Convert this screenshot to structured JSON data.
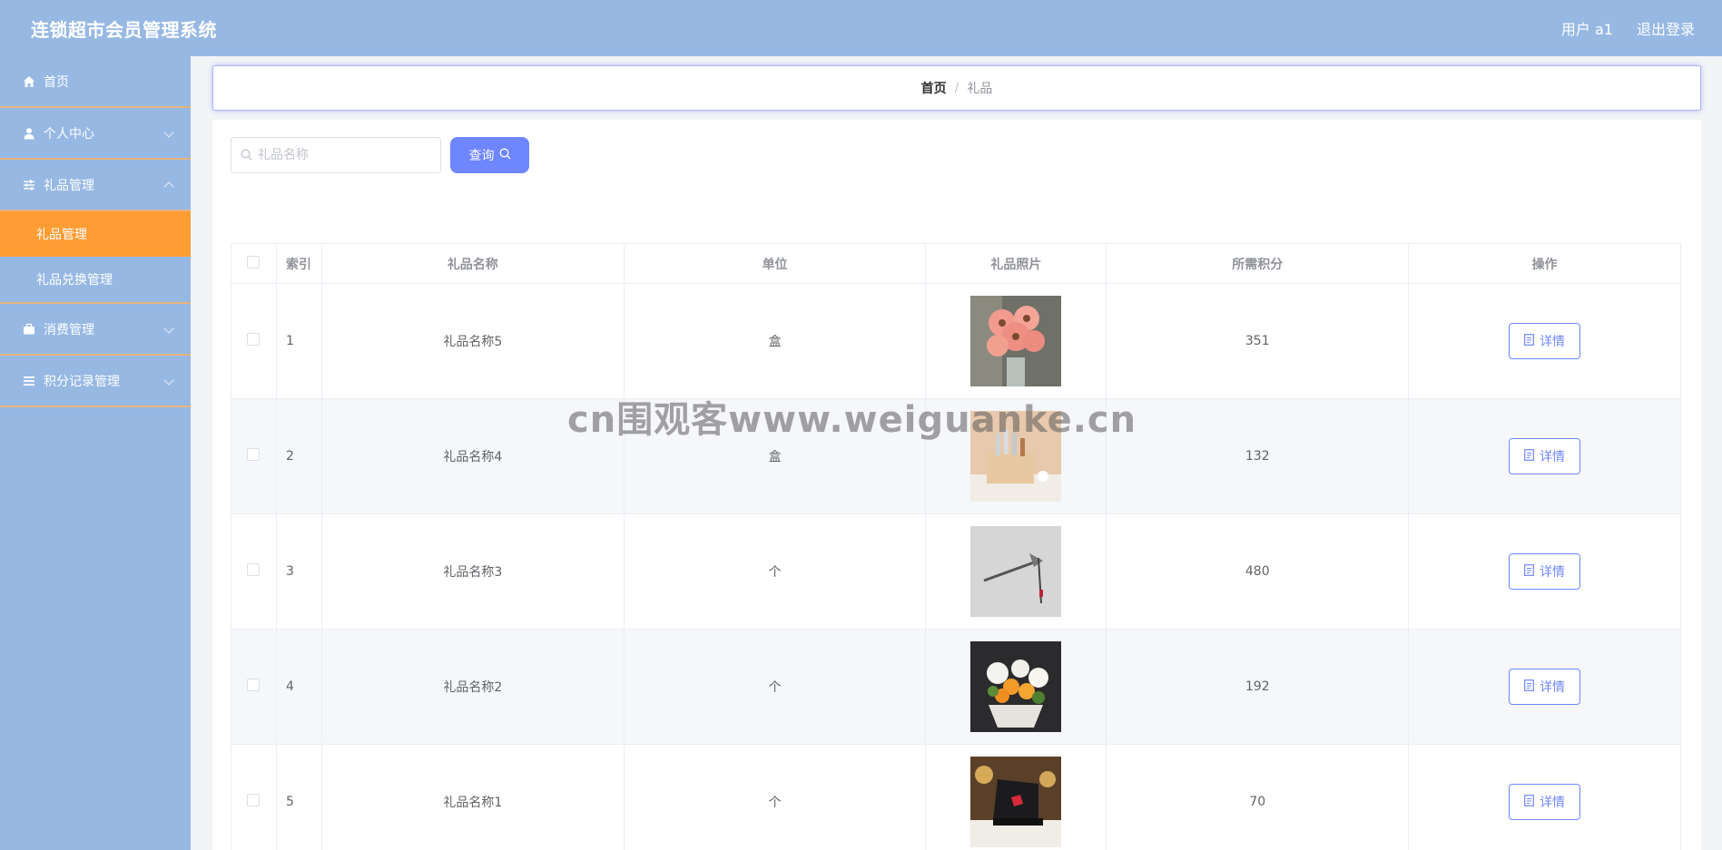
{
  "header": {
    "title": "连锁超市会员管理系统",
    "user": "用户 a1",
    "logout": "退出登录"
  },
  "sidebar": {
    "items": [
      {
        "label": "首页",
        "icon": "home-icon"
      },
      {
        "label": "个人中心",
        "icon": "user-icon"
      },
      {
        "label": "礼品管理",
        "icon": "sliders-icon"
      },
      {
        "label": "消费管理",
        "icon": "briefcase-icon"
      },
      {
        "label": "积分记录管理",
        "icon": "menu-icon"
      }
    ],
    "sub_items": [
      {
        "label": "礼品管理"
      },
      {
        "label": "礼品兑换管理"
      }
    ]
  },
  "breadcrumb": {
    "home": "首页",
    "separator": "/",
    "current": "礼品"
  },
  "search": {
    "placeholder": "礼品名称",
    "value": "",
    "button": "查询"
  },
  "table": {
    "headers": {
      "index": "索引",
      "name": "礼品名称",
      "unit": "单位",
      "photo": "礼品照片",
      "points": "所需积分",
      "actions": "操作"
    },
    "rows": [
      {
        "index": "1",
        "name": "礼品名称5",
        "unit": "盒",
        "points": "351",
        "action": "详情"
      },
      {
        "index": "2",
        "name": "礼品名称4",
        "unit": "盒",
        "points": "132",
        "action": "详情"
      },
      {
        "index": "3",
        "name": "礼品名称3",
        "unit": "个",
        "points": "480",
        "action": "详情"
      },
      {
        "index": "4",
        "name": "礼品名称2",
        "unit": "个",
        "points": "192",
        "action": "详情"
      },
      {
        "index": "5",
        "name": "礼品名称1",
        "unit": "个",
        "points": "70",
        "action": "详情"
      }
    ]
  },
  "watermark": "cn围观客www.weiguanke.cn",
  "colors": {
    "header_bg": "#97b8e3",
    "active_menu": "#ff9d35",
    "primary": "#6e86ff"
  }
}
